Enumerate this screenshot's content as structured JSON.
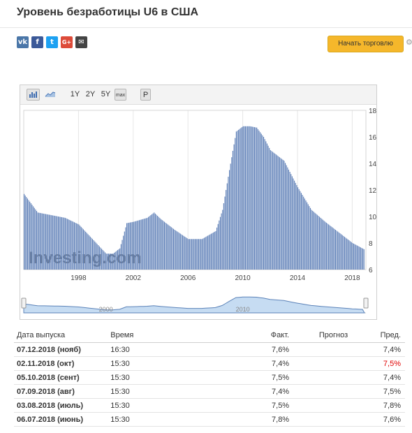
{
  "header": {
    "title": "Уровень безработицы U6 в США",
    "trade_button": "Начать торговлю",
    "social_icons": [
      "vk-icon",
      "facebook-icon",
      "twitter-icon",
      "google-plus-icon",
      "mail-icon"
    ],
    "social_glyphs": [
      "vk",
      "f",
      "t",
      "G+",
      "✉"
    ],
    "social_colors": [
      "#4a76a8",
      "#3b5998",
      "#1da1f2",
      "#dd4b39",
      "#444444"
    ]
  },
  "toolbar": {
    "periods": [
      "1Y",
      "2Y",
      "5Y",
      "max"
    ],
    "p_label": "P"
  },
  "chart_data": {
    "type": "bar",
    "y_ticks": [
      6,
      8,
      10,
      12,
      14,
      16,
      18
    ],
    "x_ticks": [
      "1998",
      "2002",
      "2006",
      "2010",
      "2014",
      "2018"
    ],
    "navigator_labels": [
      "2000",
      "2010"
    ],
    "ylim": [
      6,
      18
    ],
    "watermark": "Investing.com",
    "x": [
      1994.0,
      1995.0,
      1996.0,
      1997.0,
      1998.0,
      1999.0,
      2000.0,
      2000.5,
      2001.0,
      2001.5,
      2002.0,
      2003.0,
      2003.5,
      2004.0,
      2005.0,
      2006.0,
      2007.0,
      2008.0,
      2008.5,
      2009.0,
      2009.5,
      2010.0,
      2010.5,
      2011.0,
      2011.5,
      2012.0,
      2013.0,
      2014.0,
      2015.0,
      2016.0,
      2017.0,
      2018.0,
      2018.9
    ],
    "values": [
      11.7,
      10.3,
      10.1,
      9.9,
      9.4,
      8.3,
      7.2,
      7.2,
      7.6,
      9.5,
      9.6,
      9.9,
      10.3,
      9.8,
      9.0,
      8.3,
      8.3,
      8.9,
      10.5,
      13.5,
      16.4,
      16.8,
      16.8,
      16.7,
      16.0,
      15.0,
      14.2,
      12.2,
      10.5,
      9.6,
      8.8,
      8.0,
      7.5
    ]
  },
  "table": {
    "headers": {
      "date": "Дата выпуска",
      "time": "Время",
      "actual": "Факт.",
      "forecast": "Прогноз",
      "previous": "Пред."
    },
    "rows": [
      {
        "date": "07.12.2018 (нояб)",
        "time": "16:30",
        "actual": "7,6%",
        "forecast": "",
        "previous": "7,4%",
        "prev_color": "#333333"
      },
      {
        "date": "02.11.2018 (окт)",
        "time": "15:30",
        "actual": "7,4%",
        "forecast": "",
        "previous": "7,5%",
        "prev_color": "#e00000"
      },
      {
        "date": "05.10.2018 (сент)",
        "time": "15:30",
        "actual": "7,5%",
        "forecast": "",
        "previous": "7,4%",
        "prev_color": "#333333"
      },
      {
        "date": "07.09.2018 (авг)",
        "time": "15:30",
        "actual": "7,4%",
        "forecast": "",
        "previous": "7,5%",
        "prev_color": "#333333"
      },
      {
        "date": "03.08.2018 (июль)",
        "time": "15:30",
        "actual": "7,5%",
        "forecast": "",
        "previous": "7,8%",
        "prev_color": "#333333"
      },
      {
        "date": "06.07.2018 (июнь)",
        "time": "15:30",
        "actual": "7,8%",
        "forecast": "",
        "previous": "7,6%",
        "prev_color": "#333333"
      }
    ]
  },
  "colors": {
    "bar": "#5b7db6",
    "grid": "#e6e6e6",
    "navigator_fill": "#c6dcf2",
    "navigator_line": "#5b82b8"
  }
}
